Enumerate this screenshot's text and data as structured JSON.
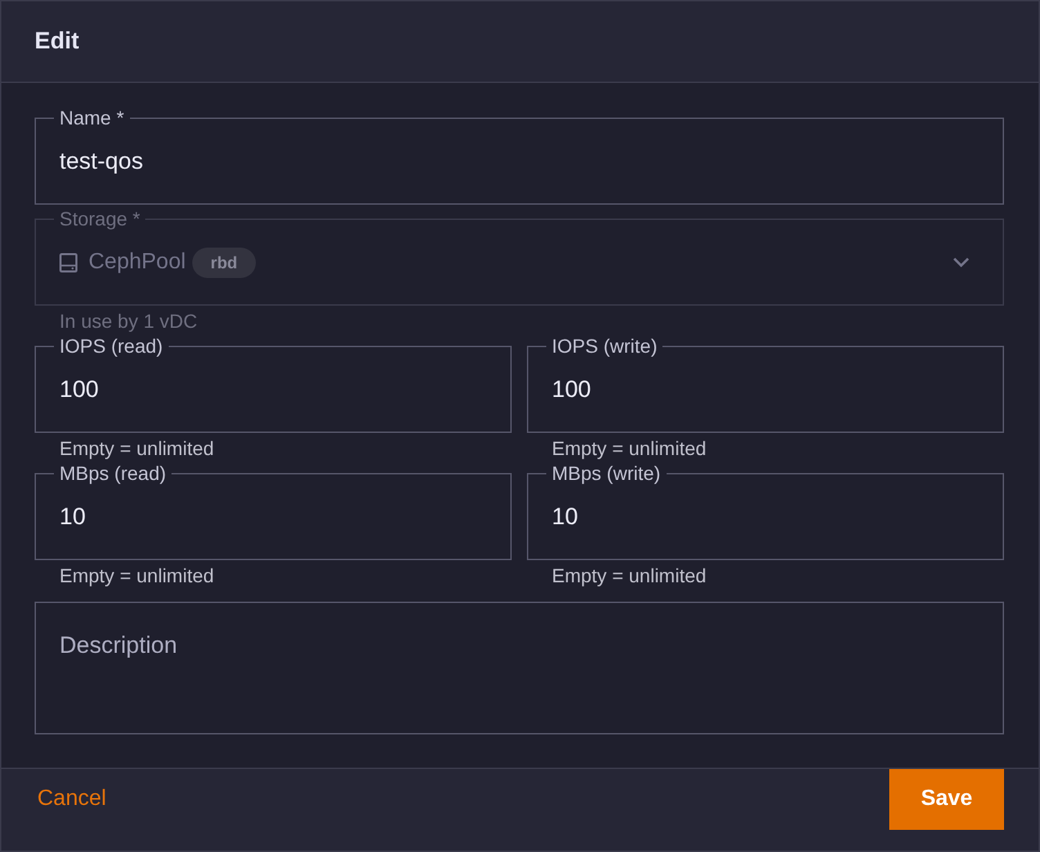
{
  "dialog": {
    "title": "Edit"
  },
  "form": {
    "rows": [
      {
        "fields": [
          {
            "kind": "text",
            "label": "Name *",
            "value": "test-qos",
            "disabled": false
          }
        ]
      },
      {
        "fields": [
          {
            "kind": "select",
            "label": "Storage *",
            "value": "CephPool",
            "tag": "rbd",
            "disabled": true,
            "helper": "In use by 1 vDC"
          }
        ]
      },
      {
        "fields": [
          {
            "kind": "text",
            "label": "IOPS (read)",
            "value": "100",
            "disabled": false,
            "helper": "Empty = unlimited"
          },
          {
            "kind": "text",
            "label": "IOPS (write)",
            "value": "100",
            "disabled": false,
            "helper": "Empty = unlimited"
          }
        ]
      },
      {
        "fields": [
          {
            "kind": "text",
            "label": "MBps (read)",
            "value": "10",
            "disabled": false,
            "helper": "Empty = unlimited"
          },
          {
            "kind": "text",
            "label": "MBps (write)",
            "value": "10",
            "disabled": false,
            "helper": "Empty = unlimited"
          }
        ]
      },
      {
        "fields": [
          {
            "kind": "textarea",
            "placeholder": "Description",
            "disabled": false
          }
        ]
      }
    ]
  },
  "footer": {
    "buttons": [
      {
        "kind": "text",
        "label": "Cancel"
      },
      {
        "kind": "contained",
        "label": "Save"
      }
    ]
  }
}
